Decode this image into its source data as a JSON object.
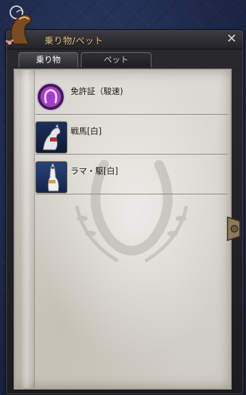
{
  "window": {
    "title": "乗り物/ペット",
    "close_label": "✕"
  },
  "tabs": [
    {
      "label": "乗り物",
      "active": true
    },
    {
      "label": "ペット",
      "active": false
    }
  ],
  "items": [
    {
      "label": "免許証（駿速)",
      "icon": "horseshoe-badge-icon"
    },
    {
      "label": "戦馬[白]",
      "icon": "white-warhorse-icon"
    },
    {
      "label": "ラマ・駆[白]",
      "icon": "white-llama-icon"
    }
  ],
  "colors": {
    "title_text": "#e9c48a",
    "page_bg": "#d6d3cb",
    "frame": "#2a2a2e"
  }
}
